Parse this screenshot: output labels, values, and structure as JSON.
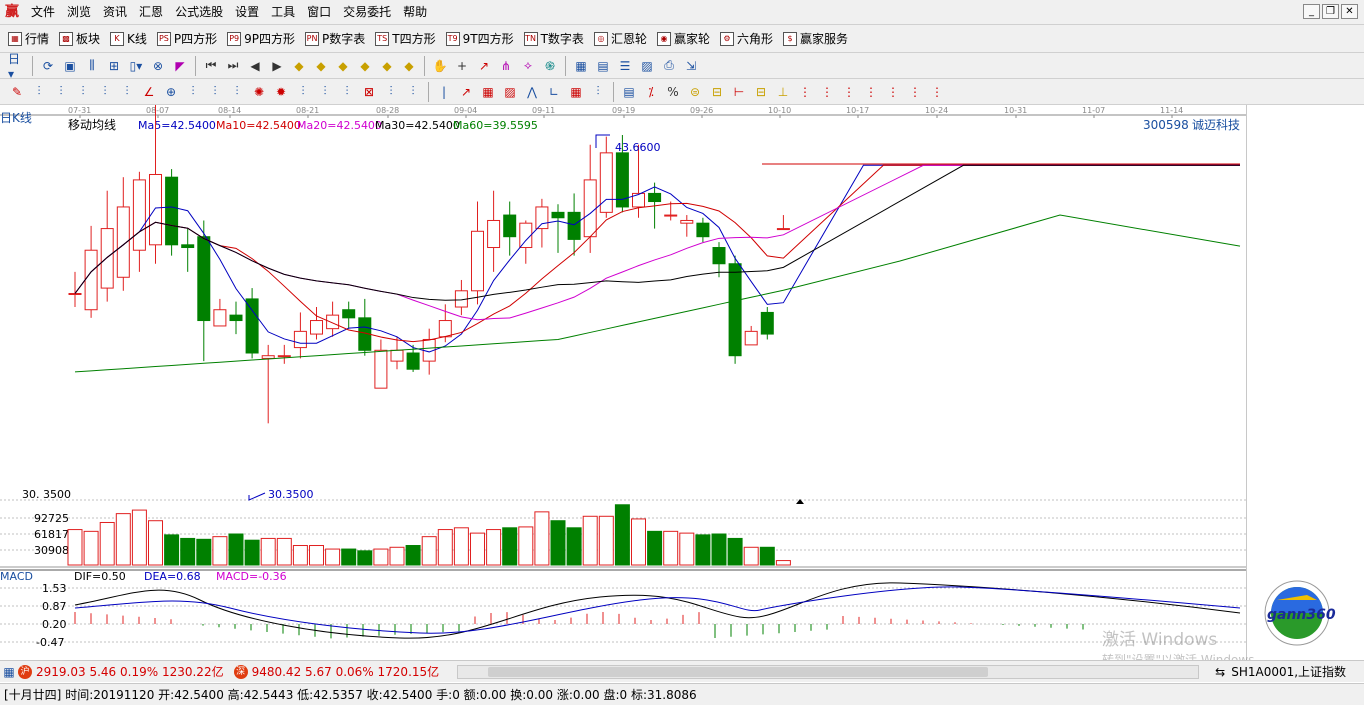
{
  "menubar": {
    "logo": "赢",
    "items": [
      "文件",
      "浏览",
      "资讯",
      "汇恩",
      "公式选股",
      "设置",
      "工具",
      "窗口",
      "交易委托",
      "帮助"
    ]
  },
  "toolbar1": [
    {
      "icon": "grid-icon",
      "glyph": "▦",
      "label": "行情"
    },
    {
      "icon": "blocks-icon",
      "glyph": "▩",
      "label": "板块"
    },
    {
      "icon": "kline-icon",
      "glyph": "K",
      "label": "K线"
    },
    {
      "icon": "p-square-icon",
      "glyph": "PS",
      "label": "P四方形"
    },
    {
      "icon": "9p-square-icon",
      "glyph": "P9",
      "label": "9P四方形"
    },
    {
      "icon": "p-number-icon",
      "glyph": "PN",
      "label": "P数字表"
    },
    {
      "icon": "t-square-icon",
      "glyph": "TS",
      "label": "T四方形"
    },
    {
      "icon": "9t-square-icon",
      "glyph": "T9",
      "label": "9T四方形"
    },
    {
      "icon": "t-number-icon",
      "glyph": "TN",
      "label": "T数字表"
    },
    {
      "icon": "huien-wheel-icon",
      "glyph": "◎",
      "label": "汇恩轮"
    },
    {
      "icon": "yingjia-wheel-icon",
      "glyph": "◉",
      "label": "赢家轮"
    },
    {
      "icon": "hexagon-icon",
      "glyph": "⚙",
      "label": "六角形"
    },
    {
      "icon": "dollar-icon",
      "glyph": "$",
      "label": "赢家服务"
    }
  ],
  "chart": {
    "period_label": "日K线",
    "indicator_label": "移动均线",
    "stock_code": "300598",
    "stock_name": "诚迈科技",
    "ma5": "Ma5=42.5400",
    "ma10": "Ma10=42.5400",
    "ma20": "Ma20=42.5400",
    "ma30": "Ma30=42.5400",
    "ma60": "Ma60=39.5595",
    "high_label": "43.6600",
    "low_label": "30.3500",
    "low_axis_label": "30. 3500",
    "date_ticks": [
      "07-31",
      "08-07",
      "08-14",
      "08-21",
      "08-28",
      "09-04",
      "09-11",
      "09-19",
      "09-26",
      "10-10",
      "10-17",
      "10-24",
      "10-31",
      "11-07",
      "11-14"
    ],
    "volume_ticks": [
      "92725",
      "61817",
      "30908"
    ],
    "macd_label": "MACD",
    "dif": "DIF=0.50",
    "dea": "DEA=0.68",
    "macd_val": "MACD=-0.36",
    "macd_ticks": [
      "1.53",
      "0.87",
      "0.20",
      "-0.47"
    ],
    "colors": {
      "up": "#e02020",
      "down": "#008000",
      "ma5": "#0000c0",
      "ma10": "#d00000",
      "ma20": "#d000d0",
      "ma30": "#000000",
      "ma60": "#008000"
    }
  },
  "chart_data": {
    "type": "candlestick",
    "candles": [
      {
        "o": 37.8,
        "c": 37.8,
        "h": 38.6,
        "l": 37.3
      },
      {
        "o": 37.2,
        "c": 39.4,
        "h": 40.3,
        "l": 36.9
      },
      {
        "o": 38.0,
        "c": 40.2,
        "h": 41.6,
        "l": 37.5
      },
      {
        "o": 38.4,
        "c": 41.0,
        "h": 42.1,
        "l": 37.9
      },
      {
        "o": 39.4,
        "c": 42.0,
        "h": 42.3,
        "l": 38.6
      },
      {
        "o": 39.6,
        "c": 42.2,
        "h": 44.8,
        "l": 38.9
      },
      {
        "o": 42.1,
        "c": 39.6,
        "h": 42.4,
        "l": 39.2
      },
      {
        "o": 39.6,
        "c": 39.5,
        "h": 40.2,
        "l": 38.6
      },
      {
        "o": 39.9,
        "c": 36.8,
        "h": 40.5,
        "l": 35.3
      },
      {
        "o": 36.6,
        "c": 37.2,
        "h": 37.6,
        "l": 36.6
      },
      {
        "o": 37.0,
        "c": 36.8,
        "h": 37.5,
        "l": 36.3
      },
      {
        "o": 37.6,
        "c": 35.6,
        "h": 38.0,
        "l": 35.4
      },
      {
        "o": 35.4,
        "c": 35.5,
        "h": 35.9,
        "l": 33.0
      },
      {
        "o": 35.5,
        "c": 35.5,
        "h": 35.9,
        "l": 35.2
      },
      {
        "o": 35.8,
        "c": 36.4,
        "h": 37.1,
        "l": 35.4
      },
      {
        "o": 36.3,
        "c": 36.8,
        "h": 37.3,
        "l": 36.1
      },
      {
        "o": 36.5,
        "c": 37.0,
        "h": 37.5,
        "l": 36.2
      },
      {
        "o": 37.2,
        "c": 36.9,
        "h": 37.5,
        "l": 36.5
      },
      {
        "o": 36.9,
        "c": 35.7,
        "h": 37.6,
        "l": 35.5
      },
      {
        "o": 34.3,
        "c": 35.7,
        "h": 36.1,
        "l": 34.3
      },
      {
        "o": 35.3,
        "c": 35.7,
        "h": 36.2,
        "l": 35.0
      },
      {
        "o": 35.6,
        "c": 35.0,
        "h": 35.9,
        "l": 34.9
      },
      {
        "o": 35.3,
        "c": 36.1,
        "h": 36.5,
        "l": 34.8
      },
      {
        "o": 36.2,
        "c": 36.8,
        "h": 37.4,
        "l": 36.0
      },
      {
        "o": 37.3,
        "c": 37.9,
        "h": 38.3,
        "l": 37.0
      },
      {
        "o": 37.9,
        "c": 40.1,
        "h": 41.2,
        "l": 37.4
      },
      {
        "o": 39.5,
        "c": 40.5,
        "h": 41.6,
        "l": 38.6
      },
      {
        "o": 40.7,
        "c": 39.9,
        "h": 41.2,
        "l": 39.2
      },
      {
        "o": 39.5,
        "c": 40.4,
        "h": 40.5,
        "l": 38.9
      },
      {
        "o": 40.2,
        "c": 41.0,
        "h": 41.3,
        "l": 39.5
      },
      {
        "o": 40.8,
        "c": 40.6,
        "h": 41.1,
        "l": 39.3
      },
      {
        "o": 40.8,
        "c": 39.8,
        "h": 41.5,
        "l": 39.2
      },
      {
        "o": 39.9,
        "c": 42.0,
        "h": 43.3,
        "l": 39.3
      },
      {
        "o": 40.8,
        "c": 43.0,
        "h": 43.6,
        "l": 40.6
      },
      {
        "o": 43.0,
        "c": 41.0,
        "h": 43.66,
        "l": 40.8
      },
      {
        "o": 41.0,
        "c": 41.5,
        "h": 43.3,
        "l": 40.6
      },
      {
        "o": 41.5,
        "c": 41.2,
        "h": 41.9,
        "l": 40.2
      },
      {
        "o": 40.7,
        "c": 40.7,
        "h": 41.2,
        "l": 40.5
      },
      {
        "o": 40.4,
        "c": 40.5,
        "h": 40.7,
        "l": 39.9
      },
      {
        "o": 40.4,
        "c": 39.9,
        "h": 40.6,
        "l": 39.7
      },
      {
        "o": 39.5,
        "c": 38.9,
        "h": 39.7,
        "l": 38.4
      },
      {
        "o": 38.9,
        "c": 35.5,
        "h": 39.2,
        "l": 35.2
      },
      {
        "o": 35.9,
        "c": 36.4,
        "h": 36.6,
        "l": 35.9
      },
      {
        "o": 37.1,
        "c": 36.3,
        "h": 37.3,
        "l": 36.1
      },
      {
        "o": 40.2,
        "c": 40.2,
        "h": 40.7,
        "l": 40.2
      }
    ],
    "volume": [
      40,
      38,
      48,
      58,
      62,
      50,
      34,
      30,
      29,
      32,
      35,
      28,
      30,
      30,
      22,
      22,
      18,
      18,
      16,
      18,
      20,
      22,
      32,
      40,
      42,
      36,
      40,
      42,
      43,
      60,
      50,
      42,
      55,
      55,
      68,
      52,
      38,
      38,
      36,
      34,
      35,
      30,
      20,
      20,
      5
    ]
  },
  "statusbar": {
    "idx1_badge": "沪",
    "idx1": "2919.03",
    "idx1_chg": "5.46",
    "idx1_pct": "0.19%",
    "idx1_amt": "1230.22亿",
    "idx2_badge": "深",
    "idx2": "9480.42",
    "idx2_chg": "5.67",
    "idx2_pct": "0.06%",
    "idx2_amt": "1720.15亿",
    "right": "SH1A0001,上证指数"
  },
  "infobar": {
    "date_lunar": "[十月廿四]",
    "time": "时间:20191120",
    "open": "开:42.5400",
    "high": "高:42.5443",
    "low": "低:42.5357",
    "close": "收:42.5400",
    "hand": "手:0",
    "amount": "额:0.00",
    "turnover": "换:0.00",
    "change": "涨:0.00",
    "pan": "盘:0",
    "mark": "标:31.8086"
  },
  "watermark": {
    "line1": "激活 Windows",
    "line2": "转到\"设置\"以激活 Windows。"
  },
  "logo": {
    "text": "gann360"
  }
}
